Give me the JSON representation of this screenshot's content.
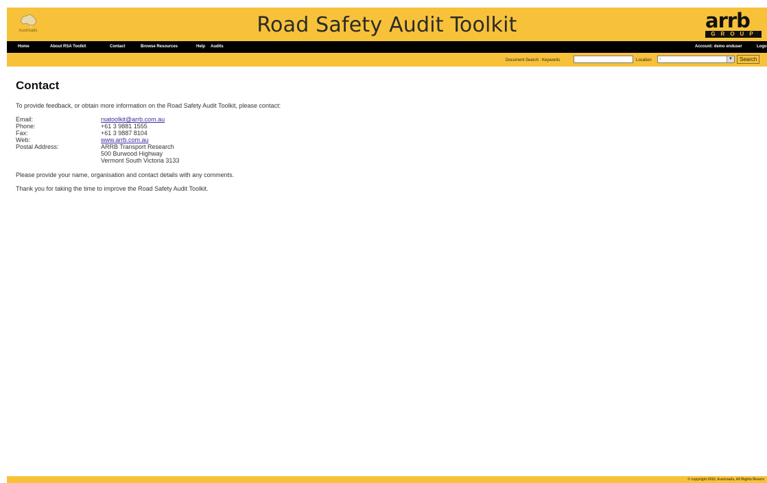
{
  "header": {
    "logo_left_label": "Austroads",
    "title": "Road Safety Audit Toolkit",
    "logo_right_word": "arrb",
    "logo_right_sub": "GROUP"
  },
  "nav": {
    "items": [
      "Home",
      "About RSA Toolkit",
      "Contact",
      "Browse Resources",
      "Help",
      "Audits"
    ],
    "account": "Account: demo enduser",
    "logout": "Logo"
  },
  "search": {
    "keywords_label": "Document Search : Keywords",
    "keywords_value": "",
    "location_label": "Location",
    "location_value": "-",
    "button_label": "Search"
  },
  "main": {
    "title": "Contact",
    "intro": "To provide feedback, or obtain more information on the Road Safety Audit Toolkit, please contact:",
    "contact": {
      "email_label": "Email:",
      "email_value": "rsatoolkit@arrb.com.au",
      "phone_label": "Phone:",
      "phone_value": "+61 3 9881 1555",
      "fax_label": "Fax:",
      "fax_value": "+61 3 9887 8104",
      "web_label": "Web:",
      "web_value": "www.arrb.com.au",
      "postal_label": "Postal Address:",
      "postal_line1": "ARRB Transport Research",
      "postal_line2": "500 Burwood Highway",
      "postal_line3": "Vermont South Victoria 3133"
    },
    "note1": "Please provide your name, organisation and contact details with any comments.",
    "note2": "Thank you for taking the time to improve the Road Safety Audit Toolkit."
  },
  "footer": {
    "copyright": "© copyright 2010, Austroads, All Rights Reserv"
  },
  "colors": {
    "brand_yellow": "#f7c23a",
    "nav_black": "#000000",
    "link": "#3a2ea0"
  }
}
